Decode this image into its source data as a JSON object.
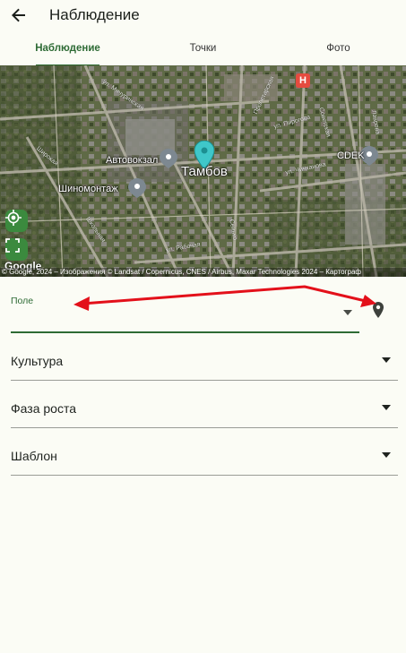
{
  "appbar": {
    "back_icon": "arrow-back-icon",
    "title": "Наблюдение"
  },
  "tabs": [
    {
      "label": "Наблюдение",
      "active": true
    },
    {
      "label": "Точки",
      "active": false
    },
    {
      "label": "Фото",
      "active": false
    }
  ],
  "map": {
    "labels": {
      "city": "Тамбов",
      "bus_station": "Автовокзал",
      "tire": "Шиномонтаж",
      "cdek": "CDEK",
      "hospital_marker": "H"
    },
    "streets": {
      "s1": "ул. Мичуринская",
      "s2": "ул. Пирогова",
      "s3": "ул. Чичканова",
      "s4": "Широкая",
      "s5": "ул. Рабочая",
      "s6": "Пролетарская",
      "s7": "Сенько",
      "s8": "Советская",
      "s9": "Лаврова",
      "s10": "Школьная"
    },
    "google": "Google",
    "copyright": "© Google, 2024 – Изображения © Landsat / Copernicus, CNES / Airbus, Maxar Technologies 2024 – Картограф",
    "controls": [
      "my-location-icon",
      "fit-bounds-icon"
    ]
  },
  "form": {
    "field_label": "Поле",
    "culture_label": "Культура",
    "phase_label": "Фаза роста",
    "template_label": "Шаблон"
  },
  "colors": {
    "accent": "#2e6b35",
    "background": "#fbfcf5",
    "annotation": "#e3101a",
    "map_pin": "#3fc7c9"
  }
}
